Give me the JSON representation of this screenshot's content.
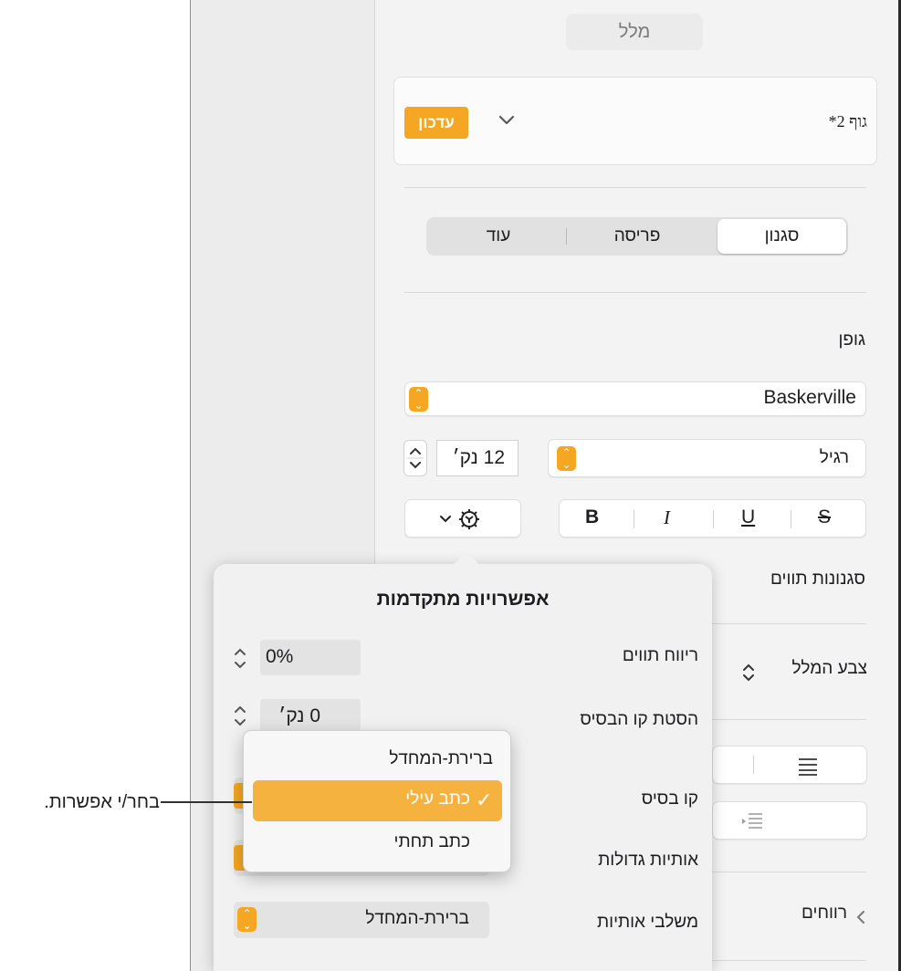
{
  "inspector": {
    "tab_title": "מלל",
    "paragraph_style": {
      "name": "גוף 2*",
      "update_label": "עדכון",
      "chevron_icon": "chevron-down-icon"
    },
    "segments": [
      "סגנון",
      "פריסה",
      "עוד"
    ],
    "selected_segment": "סגנון",
    "font": {
      "section_label": "גופן",
      "family": "Baskerville",
      "typeface": "רגיל",
      "size": "12 נק׳",
      "format_buttons": [
        "B",
        "I",
        "U",
        "S"
      ],
      "gear_icon": "gear-icon"
    },
    "character_styles_label": "סגנונות תווים",
    "text_color_label": "צבע המלל",
    "spacing_label": "רווחים"
  },
  "advanced_popover": {
    "title": "אפשרויות מתקדמות",
    "character_spacing_label": "ריווח תווים",
    "character_spacing_value": "0%",
    "baseline_shift_label": "הסטת קו הבסיס",
    "baseline_shift_value": "0 נק׳",
    "baseline_label": "קו בסיס",
    "capitalization_label": "אותיות גדולות",
    "ligatures_label": "משלבי אותיות",
    "ligatures_value": "ברירת-המחדל"
  },
  "baseline_menu": {
    "items": [
      "ברירת-המחדל",
      "כתב עילי",
      "כתב תחתי"
    ],
    "selected": "כתב עילי",
    "checkmark": "✓"
  },
  "callout": {
    "text": "בחר/י אפשרות."
  },
  "colors": {
    "accent": "#f5a623",
    "menu_highlight": "#f5b23f"
  }
}
